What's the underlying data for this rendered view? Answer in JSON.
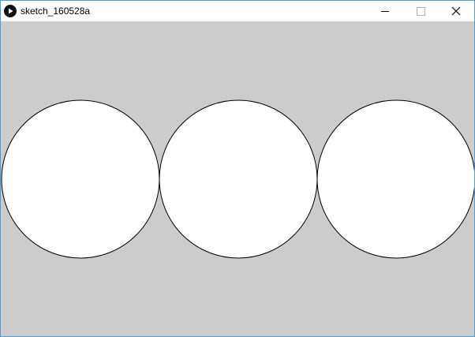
{
  "window": {
    "title": "sketch_160528a",
    "app_icon": "processing-play-icon",
    "controls": [
      "minimize-icon",
      "maximize-icon",
      "close-icon"
    ]
  },
  "sketch": {
    "background_color": "#cccccc",
    "shapes": [
      {
        "type": "ellipse",
        "fill": "#ffffff",
        "stroke": "#000000"
      },
      {
        "type": "ellipse",
        "fill": "#ffffff",
        "stroke": "#000000"
      },
      {
        "type": "ellipse",
        "fill": "#ffffff",
        "stroke": "#000000"
      }
    ]
  },
  "colors": {
    "window_border": "#4a9bd6",
    "titlebar": "#ffffff"
  }
}
